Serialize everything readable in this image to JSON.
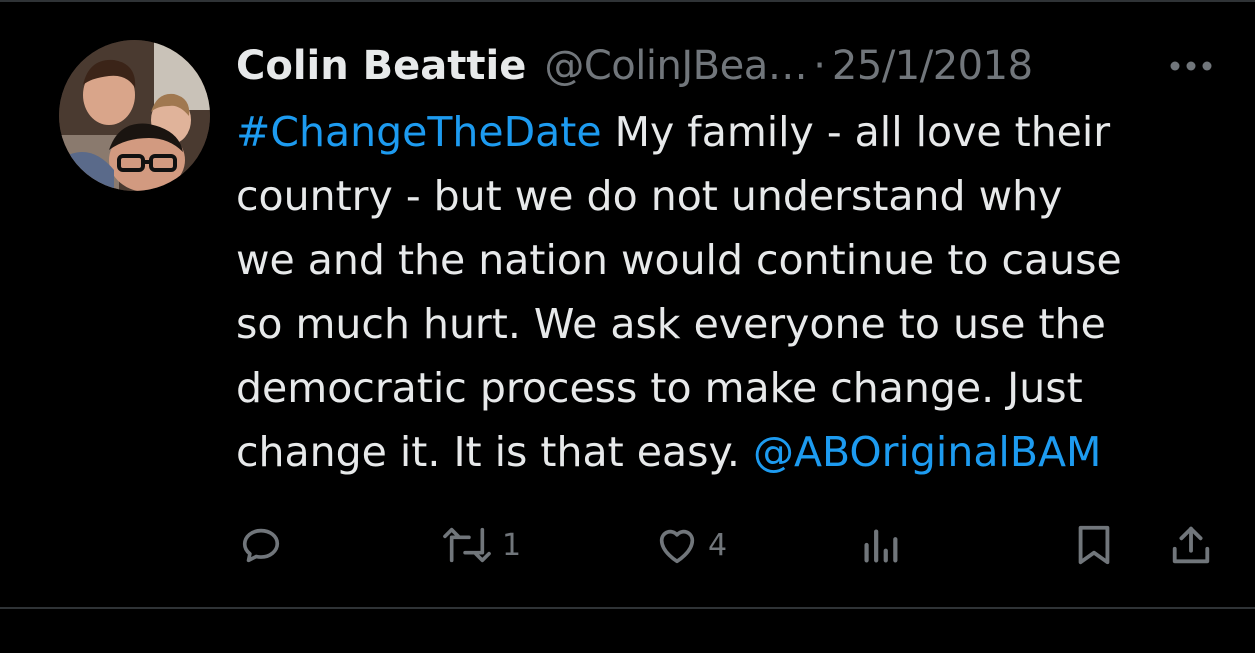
{
  "tweet": {
    "author": {
      "display_name": "Colin Beattie",
      "handle": "@ColinJBea…",
      "avatar_icon": "profile-photo"
    },
    "separator": "·",
    "date": "25/1/2018",
    "more_icon": "more-horizontal-icon",
    "text": {
      "hashtag": "#ChangeTheDate",
      "body": " My family - all love their\ncountry - but we do not understand why\nwe and the nation would continue to cause\nso much hurt. We ask everyone to use the\ndemocratic process to make change. Just\nchange it. It is that easy. ",
      "mention": "@ABOriginalBAM"
    },
    "actions": {
      "reply": {
        "icon": "reply-icon",
        "count": ""
      },
      "retweet": {
        "icon": "retweet-icon",
        "count": "1"
      },
      "like": {
        "icon": "heart-icon",
        "count": "4"
      },
      "views": {
        "icon": "views-chart-icon",
        "count": ""
      },
      "bookmark": {
        "icon": "bookmark-icon"
      },
      "share": {
        "icon": "share-icon"
      }
    }
  },
  "colors": {
    "background": "#000000",
    "text_primary": "#e7e9ea",
    "text_secondary": "#71767b",
    "link": "#1d9bf0",
    "divider": "#2f3336"
  }
}
